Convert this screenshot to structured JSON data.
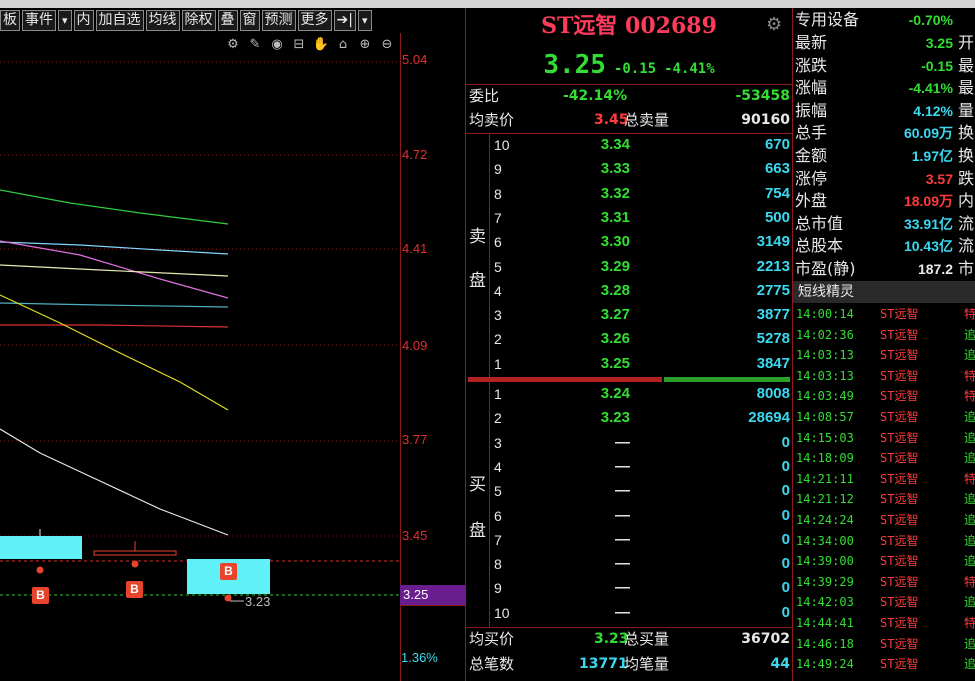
{
  "toolbar": {
    "buttons": [
      "板",
      "事件",
      "▾",
      "内",
      "加自选",
      "均线",
      "除权",
      "叠",
      "窗",
      "预测",
      "更多",
      "➔|",
      "▾"
    ]
  },
  "chart_icons": [
    "gear-icon",
    "pen-icon",
    "eye-icon",
    "lock-icon",
    "hand-icon",
    "lock2-icon",
    "zoom-in-icon",
    "zoom-out-icon"
  ],
  "price_axis": {
    "labels": [
      "5.04",
      "4.72",
      "4.41",
      "4.09",
      "3.77",
      "3.45"
    ],
    "current": "3.25",
    "percent": "1.36%",
    "low_annotation": "3.23"
  },
  "stock": {
    "name": "ST远智",
    "code": "002689",
    "price": "3.25",
    "change": "-0.15",
    "change_pct": "-4.41%"
  },
  "summary": {
    "weibi_label": "委比",
    "weibi": "-42.14%",
    "weicha": "-53458",
    "avg_sell_label": "均卖价",
    "avg_sell": "3.45",
    "total_sell_label": "总卖量",
    "total_sell": "90160",
    "avg_buy_label": "均买价",
    "avg_buy": "3.23",
    "total_buy_label": "总买量",
    "total_buy": "36702",
    "total_trades_label": "总笔数",
    "total_trades": "13771",
    "avg_trade_label": "均笔量",
    "avg_trade": "44"
  },
  "sell_label": [
    "卖",
    "盘"
  ],
  "buy_label": [
    "买",
    "盘"
  ],
  "sell_orders": [
    {
      "level": "10",
      "price": "3.34",
      "vol": "670"
    },
    {
      "level": "9",
      "price": "3.33",
      "vol": "663"
    },
    {
      "level": "8",
      "price": "3.32",
      "vol": "754"
    },
    {
      "level": "7",
      "price": "3.31",
      "vol": "500"
    },
    {
      "level": "6",
      "price": "3.30",
      "vol": "3149"
    },
    {
      "level": "5",
      "price": "3.29",
      "vol": "2213"
    },
    {
      "level": "4",
      "price": "3.28",
      "vol": "2775"
    },
    {
      "level": "3",
      "price": "3.27",
      "vol": "3877"
    },
    {
      "level": "2",
      "price": "3.26",
      "vol": "5278"
    },
    {
      "level": "1",
      "price": "3.25",
      "vol": "3847"
    }
  ],
  "buy_orders": [
    {
      "level": "1",
      "price": "3.24",
      "vol": "8008"
    },
    {
      "level": "2",
      "price": "3.23",
      "vol": "28694"
    },
    {
      "level": "3",
      "price": "—",
      "vol": "0"
    },
    {
      "level": "4",
      "price": "—",
      "vol": "0"
    },
    {
      "level": "5",
      "price": "—",
      "vol": "0"
    },
    {
      "level": "6",
      "price": "—",
      "vol": "0"
    },
    {
      "level": "7",
      "price": "—",
      "vol": "0"
    },
    {
      "level": "8",
      "price": "—",
      "vol": "0"
    },
    {
      "level": "9",
      "price": "—",
      "vol": "0"
    },
    {
      "level": "10",
      "price": "—",
      "vol": "0"
    }
  ],
  "quote": {
    "sector": "专用设备",
    "sector_pct": "-0.70%",
    "rows": [
      {
        "label": "最新",
        "value": "3.25",
        "color": "#33dd33",
        "label2": "开"
      },
      {
        "label": "涨跌",
        "value": "-0.15",
        "color": "#33dd33",
        "label2": "最"
      },
      {
        "label": "涨幅",
        "value": "-4.41%",
        "color": "#33dd33",
        "label2": "最"
      },
      {
        "label": "振幅",
        "value": "4.12%",
        "color": "#3ad9f0",
        "label2": "量"
      },
      {
        "label": "总手",
        "value": "60.09万",
        "color": "#3ad9f0",
        "label2": "换"
      },
      {
        "label": "金额",
        "value": "1.97亿",
        "color": "#3ad9f0",
        "label2": "换"
      },
      {
        "label": "涨停",
        "value": "3.57",
        "color": "#ff3b3b",
        "label2": "跌"
      },
      {
        "label": "外盘",
        "value": "18.09万",
        "color": "#ff3b3b",
        "label2": "内"
      },
      {
        "label": "总市值",
        "value": "33.91亿",
        "color": "#3ad9f0",
        "label2": "流"
      },
      {
        "label": "总股本",
        "value": "10.43亿",
        "color": "#3ad9f0",
        "label2": "流"
      },
      {
        "label": "市盈(静)",
        "value": "187.2",
        "color": "#e8e8e8",
        "label2": "市"
      }
    ]
  },
  "duanxian": {
    "title": "短线精灵",
    "rows": [
      {
        "time": "14:00:14",
        "name": "ST远智",
        "tag": "特",
        "color": "#ff3b3b"
      },
      {
        "time": "14:02:36",
        "name": "ST远智",
        "tag": "追",
        "color": "#ff3b3b"
      },
      {
        "time": "14:03:13",
        "name": "ST远智",
        "tag": "追",
        "color": "#ff3b3b"
      },
      {
        "time": "14:03:13",
        "name": "ST远智",
        "tag": "特",
        "color": "#ff3b3b"
      },
      {
        "time": "14:03:49",
        "name": "ST远智",
        "tag": "特",
        "color": "#ff3b3b"
      },
      {
        "time": "14:08:57",
        "name": "ST远智",
        "tag": "追",
        "color": "#ff3b3b"
      },
      {
        "time": "14:15:03",
        "name": "ST远智",
        "tag": "追",
        "color": "#ff3b3b"
      },
      {
        "time": "14:18:09",
        "name": "ST远智",
        "tag": "追",
        "color": "#ff3b3b"
      },
      {
        "time": "14:21:11",
        "name": "ST远智",
        "tag": "特",
        "color": "#ff3b3b"
      },
      {
        "time": "14:21:12",
        "name": "ST远智",
        "tag": "追",
        "color": "#ff3b3b"
      },
      {
        "time": "14:24:24",
        "name": "ST远智",
        "tag": "追",
        "color": "#ff3b3b"
      },
      {
        "time": "14:34:00",
        "name": "ST远智",
        "tag": "追",
        "color": "#ff3b3b"
      },
      {
        "time": "14:39:00",
        "name": "ST远智",
        "tag": "追",
        "color": "#ff3b3b"
      },
      {
        "time": "14:39:29",
        "name": "ST远智",
        "tag": "特",
        "color": "#ff3b3b"
      },
      {
        "time": "14:42:03",
        "name": "ST远智",
        "tag": "追",
        "color": "#ff3b3b"
      },
      {
        "time": "14:44:41",
        "name": "ST远智",
        "tag": "特",
        "color": "#ff3b3b"
      },
      {
        "time": "14:46:18",
        "name": "ST远智",
        "tag": "追",
        "color": "#ff3b3b"
      },
      {
        "time": "14:49:24",
        "name": "ST远智",
        "tag": "追",
        "color": "#ff3b3b"
      }
    ]
  },
  "candle_marks": [
    "B",
    "B",
    "B"
  ]
}
